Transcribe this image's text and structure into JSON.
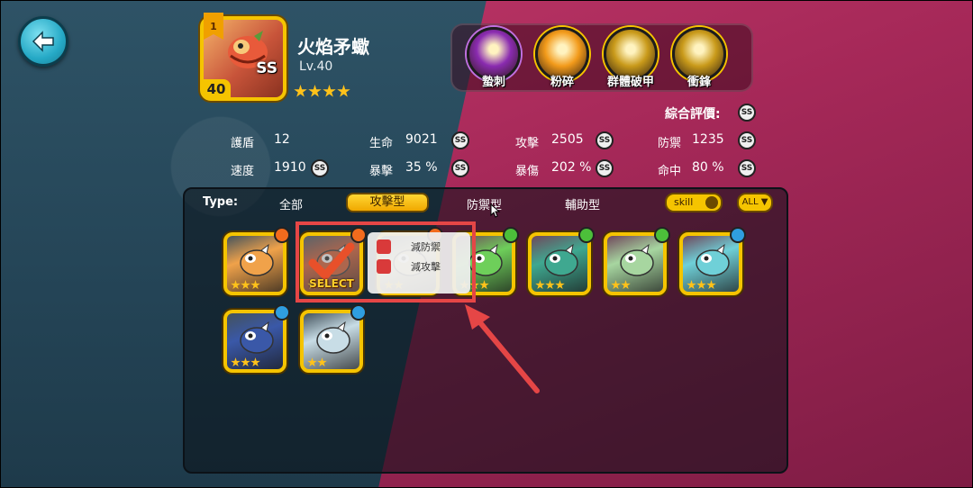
{
  "hero": {
    "name": "火焰矛蠍",
    "level": "Lv.40",
    "rank": "SS",
    "level_badge": "40",
    "ribbon": "1",
    "stars_filled": 4,
    "stars_total": 4
  },
  "skills": [
    {
      "label": "蟄刺",
      "color": "#8a2bb0"
    },
    {
      "label": "粉碎",
      "color": "#f29a1a"
    },
    {
      "label": "群體破甲",
      "color": "#c99a1a"
    },
    {
      "label": "衝鋒",
      "color": "#c99a1a"
    }
  ],
  "overall": {
    "label": "綜合評價:",
    "grade": "SS"
  },
  "stats": [
    {
      "label": "護盾",
      "value": "12",
      "grade": ""
    },
    {
      "label": "生命",
      "value": "9021",
      "grade": "SS"
    },
    {
      "label": "攻擊",
      "value": "2505",
      "grade": "SS"
    },
    {
      "label": "防禦",
      "value": "1235",
      "grade": "SS"
    },
    {
      "label": "速度",
      "value": "1910",
      "grade": "SS"
    },
    {
      "label": "暴擊",
      "value": "35 %",
      "grade": "SS"
    },
    {
      "label": "暴傷",
      "value": "202 %",
      "grade": "SS"
    },
    {
      "label": "命中",
      "value": "80 %",
      "grade": "SS"
    }
  ],
  "filter": {
    "type_label": "Type:",
    "tabs": [
      "全部",
      "攻擊型",
      "防禦型",
      "輔助型"
    ],
    "active_tab": "攻擊型",
    "skill_toggle": "skill",
    "all_button": "ALL ▼"
  },
  "cards": [
    {
      "element": "fire",
      "stars": 3,
      "color": "#f0a24a"
    },
    {
      "element": "fire",
      "stars": 2,
      "color": "#d9582b",
      "selected": true,
      "select_label": "SELECT"
    },
    {
      "element": "fire",
      "stars": 2,
      "color": "#e0d6a0"
    },
    {
      "element": "leaf",
      "stars": 3,
      "color": "#6ecf5a"
    },
    {
      "element": "leaf",
      "stars": 3,
      "color": "#3fa890"
    },
    {
      "element": "leaf",
      "stars": 2,
      "color": "#a7d6a0"
    },
    {
      "element": "water",
      "stars": 3,
      "color": "#6fd0d8"
    },
    {
      "element": "water",
      "stars": 3,
      "color": "#3a58a8"
    },
    {
      "element": "water",
      "stars": 2,
      "color": "#c8dde6"
    }
  ],
  "tooltip": {
    "items": [
      "減防禦",
      "減攻擊"
    ]
  },
  "colors": {
    "fire": "#f26b1d",
    "leaf": "#4cbf3a",
    "water": "#2f9ee0",
    "gold": "#f5c400",
    "highlight": "#e54646"
  }
}
